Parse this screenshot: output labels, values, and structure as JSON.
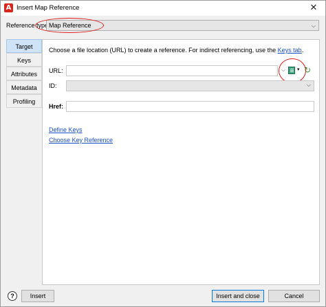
{
  "window": {
    "title": "Insert Map Reference",
    "app_icon": "A",
    "close_glyph": "✕"
  },
  "reference_type": {
    "label": "Reference type:",
    "value": "Map Reference"
  },
  "tabs": [
    {
      "label": "Target",
      "active": true
    },
    {
      "label": "Keys",
      "active": false
    },
    {
      "label": "Attributes",
      "active": false
    },
    {
      "label": "Metadata",
      "active": false
    },
    {
      "label": "Profiling",
      "active": false
    }
  ],
  "target_panel": {
    "description_prefix": "Choose a file location (URL) to create a reference. For indirect referencing, use the ",
    "description_link": "Keys tab",
    "description_suffix": ".",
    "url_label": "URL:",
    "url_value": "",
    "id_label": "ID:",
    "id_value": "",
    "href_label": "Href:",
    "href_value": "",
    "define_keys_link": "Define Keys",
    "choose_key_reference_link": "Choose Key Reference"
  },
  "footer": {
    "help_label": "?",
    "insert_label": "Insert",
    "insert_close_label": "Insert and close",
    "cancel_label": "Cancel"
  },
  "icons": {
    "browse": "browse-icon",
    "refresh": "refresh-icon",
    "dropdown": "chevron-down-icon"
  },
  "colors": {
    "accent": "#0078d7",
    "link": "#1a4ec9",
    "highlight": "#e0191b",
    "active_tab": "#cfe3f6"
  }
}
